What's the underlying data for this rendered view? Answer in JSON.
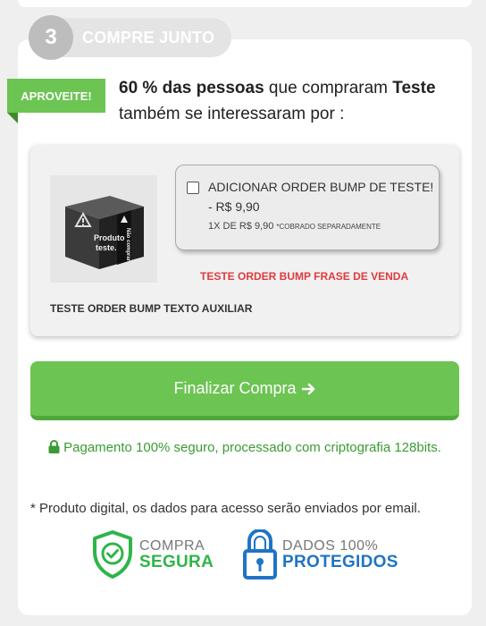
{
  "step": {
    "number": "3",
    "title": "COMPRE JUNTO"
  },
  "ribbon": {
    "label": "APROVEITE!"
  },
  "headline": {
    "percent": "60 % das pessoas",
    "middle": " que compraram ",
    "product": "Teste",
    "end": " também se interessaram por :"
  },
  "bump": {
    "image_text_1": "Produto",
    "image_text_2": "teste.",
    "image_side_text": "Não comprar",
    "title": "ADICIONAR ORDER BUMP DE TESTE!",
    "price": "- R$ 9,90",
    "installment": "1X DE R$ 9,90",
    "note": "*COBRADO SEPARADAMENTE",
    "checked": false,
    "sales_phrase": "TESTE ORDER BUMP FRASE DE VENDA",
    "aux_text": "TESTE ORDER BUMP TEXTO AUXILIAR"
  },
  "checkout": {
    "button_label": "Finalizar Compra"
  },
  "security": {
    "line": "Pagamento 100% seguro, processado com criptografia 128bits.",
    "note": "* Produto digital, os dados para acesso serão enviados por email."
  },
  "badges": {
    "secure_small": "COMPRA",
    "secure_big": "SEGURA",
    "protected_small": "DADOS 100%",
    "protected_big": "PROTEGIDOS"
  },
  "colors": {
    "accent_green": "#6cc452",
    "secure_text_green": "#3a9c33",
    "alert_red": "#e03a3e",
    "badge_blue": "#1f74c4"
  }
}
